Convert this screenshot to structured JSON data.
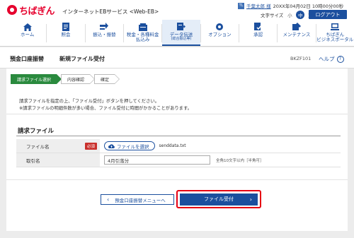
{
  "header": {
    "logo_text": "ちばぎん",
    "service_name": "インターネットEBサービス <Web-EB>",
    "user_icon_text": "TL",
    "user_name": "千葉太郎 様",
    "last_login": "20XX年04月02日 10時00分00秒",
    "font_size_label": "文字サイズ",
    "font_small": "小",
    "font_mid": "中",
    "font_large": "大",
    "logout_label": "ログアウト"
  },
  "nav": {
    "items": [
      {
        "label": "ホーム",
        "icon": "home-icon"
      },
      {
        "label": "照会",
        "icon": "inquiry-icon"
      },
      {
        "label": "振込・振替",
        "icon": "transfer-icon"
      },
      {
        "label": "税金・各種料金払込み",
        "line1": "税金・各種料金",
        "line2": "払込み",
        "icon": "tax-payment-icon"
      },
      {
        "label": "データ伝送",
        "sub": "(総合振込等)",
        "icon": "data-transmission-icon",
        "active": true
      },
      {
        "label": "オプション",
        "icon": "option-icon"
      },
      {
        "label": "承認",
        "icon": "approval-icon"
      },
      {
        "label": "メンテナンス",
        "icon": "maintenance-icon"
      },
      {
        "label": "ちばぎんビジネスポータル",
        "line1": "ちばぎん",
        "line2": "ビジネスポータル",
        "icon": "portal-icon"
      }
    ]
  },
  "page": {
    "title": "預金口座振替",
    "subtitle": "新規ファイル受付",
    "screen_id": "BKZF101",
    "help_label": "ヘルプ",
    "help_icon": "?"
  },
  "steps": [
    {
      "label": "請求ファイル選択",
      "active": true
    },
    {
      "label": "内容確認",
      "active": false
    },
    {
      "label": "確定",
      "active": false
    }
  ],
  "instructions": {
    "line1": "請求ファイルを指定の上、「ファイル受付」ボタンを押してください。",
    "line2": "※請求ファイルの明細件数が多い場合、ファイル受付に時間がかかることがあります。"
  },
  "section": {
    "title": "請求ファイル"
  },
  "form": {
    "file": {
      "label": "ファイル名",
      "required": "必須",
      "button_label": "ファイルを選択",
      "selected_file": "senddata.txt"
    },
    "name": {
      "label": "取引名",
      "value": "4月引落分",
      "hint": "全角10文字以内［半角可］"
    }
  },
  "buttons": {
    "back_label": "預金口座振替メニューへ",
    "submit_label": "ファイル受付"
  },
  "colors": {
    "brand_red": "#e6002d",
    "nav_blue": "#1b4f9e",
    "step_active_green": "#2a8a3e",
    "highlight_red": "#e60012"
  }
}
